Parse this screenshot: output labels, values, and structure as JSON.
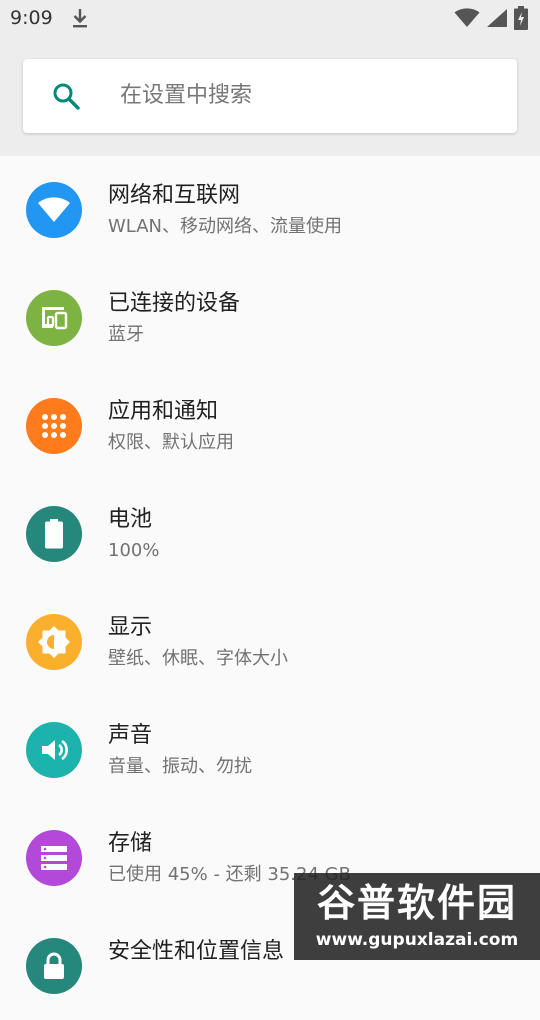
{
  "status_bar": {
    "time": "9:09",
    "icons": [
      "download-icon",
      "wifi-icon",
      "signal-icon",
      "battery-charging-icon"
    ]
  },
  "search": {
    "placeholder": "在设置中搜索",
    "icon": "search-icon",
    "accent": "#00897b"
  },
  "settings_items": [
    {
      "title": "网络和互联网",
      "subtitle": "WLAN、移动网络、流量使用",
      "icon": "wifi-icon",
      "color": "#2196f3"
    },
    {
      "title": "已连接的设备",
      "subtitle": "蓝牙",
      "icon": "devices-icon",
      "color": "#7cb342"
    },
    {
      "title": "应用和通知",
      "subtitle": "权限、默认应用",
      "icon": "apps-grid-icon",
      "color": "#ff7b1c"
    },
    {
      "title": "电池",
      "subtitle": "100%",
      "icon": "battery-icon",
      "color": "#26877c"
    },
    {
      "title": "显示",
      "subtitle": "壁纸、休眠、字体大小",
      "icon": "brightness-icon",
      "color": "#fbb02d"
    },
    {
      "title": "声音",
      "subtitle": "音量、振动、勿扰",
      "icon": "volume-icon",
      "color": "#1db3ad"
    },
    {
      "title": "存储",
      "subtitle": "已使用 45% - 还剩 35.24 GB",
      "icon": "storage-icon",
      "color": "#b249d9"
    },
    {
      "title": "安全性和位置信息",
      "subtitle": "",
      "icon": "lock-icon",
      "color": "#26877c"
    }
  ],
  "watermark": {
    "title": "谷普软件园",
    "url": "www.gupuxlazai.com"
  }
}
